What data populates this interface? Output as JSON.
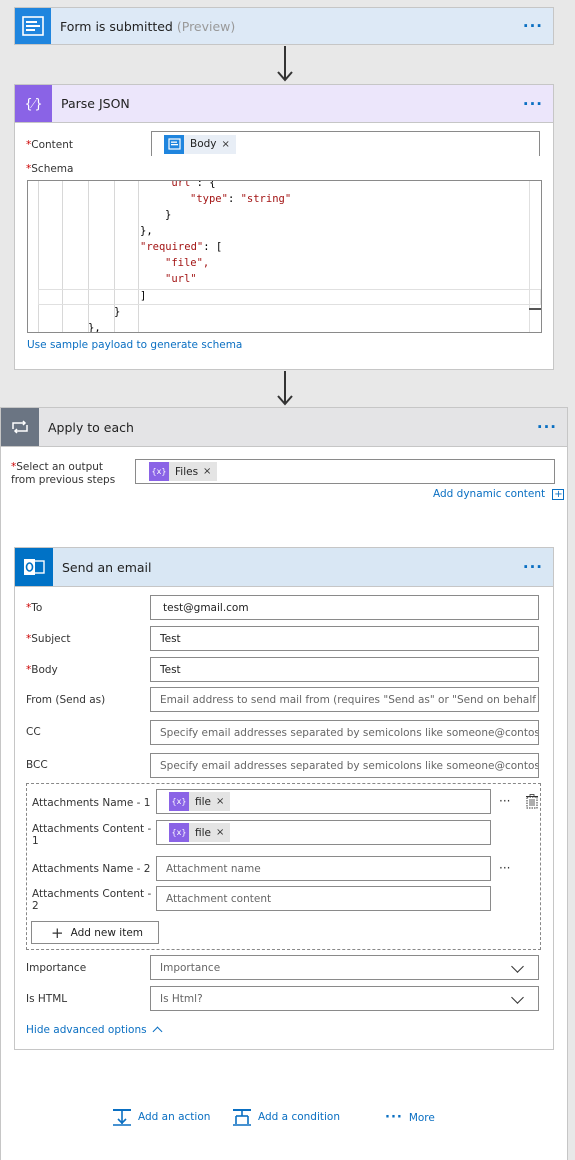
{
  "trigger": {
    "title": "Form is submitted",
    "tag": "(Preview)",
    "more": "···"
  },
  "parse_json": {
    "title": "Parse JSON",
    "more": "···",
    "content_label": "Content",
    "content_token": "Body",
    "schema_label": "Schema",
    "code": {
      "l1a": "\"url\"",
      "l1b": ": {",
      "l2a": "\"type\"",
      "l2b": ": ",
      "l2c": "\"string\"",
      "l3": "}",
      "l4": "},",
      "l5a": "\"required\"",
      "l5b": ": [",
      "l6": "\"file\",",
      "l7": "\"url\"",
      "l8": "]",
      "l9": "}",
      "l10": "},"
    },
    "sample_link": "Use sample payload to generate schema"
  },
  "apply_each": {
    "title": "Apply to each",
    "more": "···",
    "select_label_1": "Select an output",
    "select_label_2": "from previous steps",
    "files_token": "Files",
    "dynamic_link": "Add dynamic content"
  },
  "email": {
    "title": "Send an email",
    "more": "···",
    "to_label": "To",
    "to_value": "test@gmail.com",
    "subject_label": "Subject",
    "subject_value": "Test",
    "body_label": "Body",
    "body_value": "Test",
    "from_label": "From (Send as)",
    "from_placeholder": "Email address to send mail from (requires \"Send as\" or \"Send on behalf of\" pe",
    "cc_label": "CC",
    "cc_placeholder": "Specify email addresses separated by semicolons like someone@contoso.com",
    "bcc_label": "BCC",
    "bcc_placeholder": "Specify email addresses separated by semicolons like someone@contoso.com",
    "att_name_1_label": "Attachments Name - 1",
    "att_name_1_token": "file",
    "att_content_1_label_a": "Attachments Content -",
    "att_content_1_label_b": "1",
    "att_content_1_token": "file",
    "att_name_2_label": "Attachments Name - 2",
    "att_name_2_placeholder": "Attachment name",
    "att_content_2_label_a": "Attachments Content -",
    "att_content_2_label_b": "2",
    "att_content_2_placeholder": "Attachment content",
    "add_item": "Add new item",
    "importance_label": "Importance",
    "importance_placeholder": "Importance",
    "is_html_label": "Is HTML",
    "is_html_placeholder": "Is Html?",
    "hide_advanced": "Hide advanced options"
  },
  "footer": {
    "add_action": "Add an action",
    "add_condition": "Add a condition",
    "more": "More"
  },
  "common": {
    "required_star": "*",
    "token_close": "×",
    "token_expr_icon": "{x}",
    "row_more": "···"
  },
  "colors": {
    "trigger_bg": "#dde9f6",
    "trigger_icon": "#1f85de",
    "parse_bg": "#ece6fb",
    "parse_icon": "#8a63e6",
    "apply_bg": "#e4e4e6",
    "apply_icon": "#6b7583",
    "email_bg": "#d9e7f4",
    "email_icon": "#0072c6",
    "link": "#0a6fc2"
  }
}
